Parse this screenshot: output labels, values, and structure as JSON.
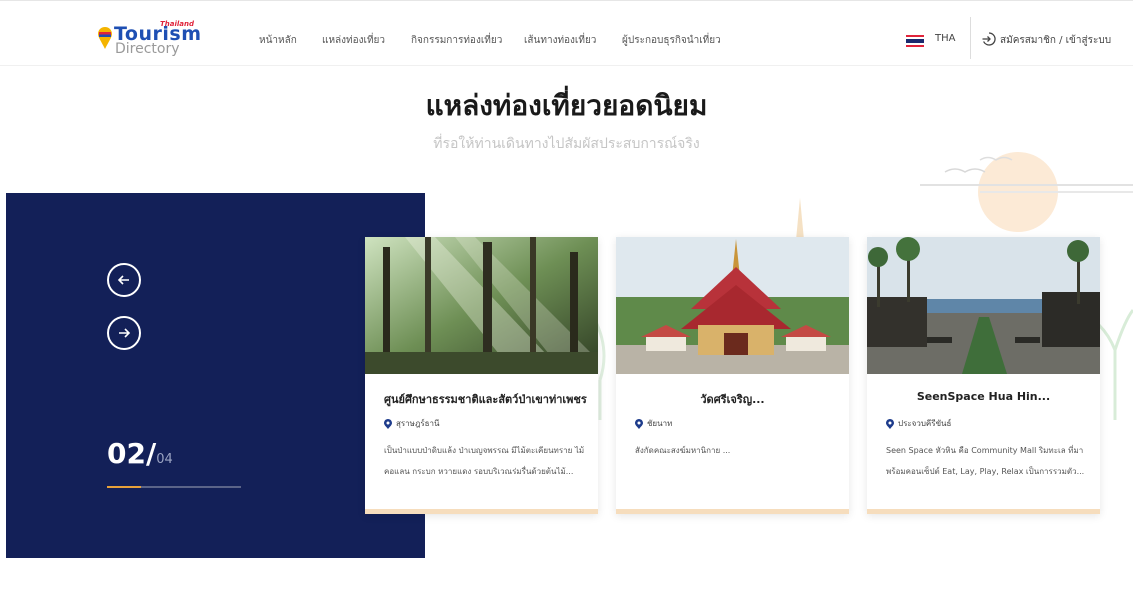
{
  "brand": {
    "small": "Thailand",
    "main": "Tourism",
    "sub": "Directory"
  },
  "nav": {
    "items": [
      "หน้าหลัก",
      "แหล่งท่องเที่ยว",
      "กิจกรรมการท่องเที่ยว",
      "เส้นทางท่องเที่ยว",
      "ผู้ประกอบธุรกิจนำเที่ยว"
    ],
    "language": "THA",
    "login": "สมัครสมาชิก / เข้าสู่ระบบ"
  },
  "section": {
    "title": "แหล่งท่องเที่ยวยอดนิยม",
    "subtitle": "ที่รอให้ท่านเดินทางไปสัมผัสประสบการณ์จริง"
  },
  "slider": {
    "current": "02/",
    "total": "04",
    "progress": 0.25,
    "prev_icon": "arrow-left-circle-icon",
    "next_icon": "arrow-right-circle-icon"
  },
  "cards": [
    {
      "name": "ศูนย์ศึกษาธรรมชาติและสัตว์ป่าเขาท่าเพชร",
      "location": "สุราษฎร์ธานี",
      "description": "เป็นป่าแบบป่าดิบแล้ง ป่าเบญจพรรณ มีไม้ตะเคียนทราย ไม้คอแลน กระบก หวายแดง รอบบริเวณร่มรื่นด้วยต้นไม้...",
      "image": "forest-photo"
    },
    {
      "name": "วัดศรีเจริญ...",
      "location": "ชัยนาท",
      "description": "สังกัดคณะสงฆ์มหานิกาย ...",
      "image": "temple-photo"
    },
    {
      "name": "SeenSpace Hua Hin...",
      "location": "ประจวบคีรีขันธ์",
      "description": "Seen Space หัวหิน คือ Community Mall ริมทะเล ที่มาพร้อมคอนเซ็ปต์ Eat, Lay, Play, Relax เป็นการรวมตัว...",
      "image": "beach-mall-photo"
    }
  ],
  "colors": {
    "navy": "#132058",
    "accent": "#e8a13a",
    "brand_blue": "#1e4fb3",
    "brand_red": "#e0243b"
  }
}
